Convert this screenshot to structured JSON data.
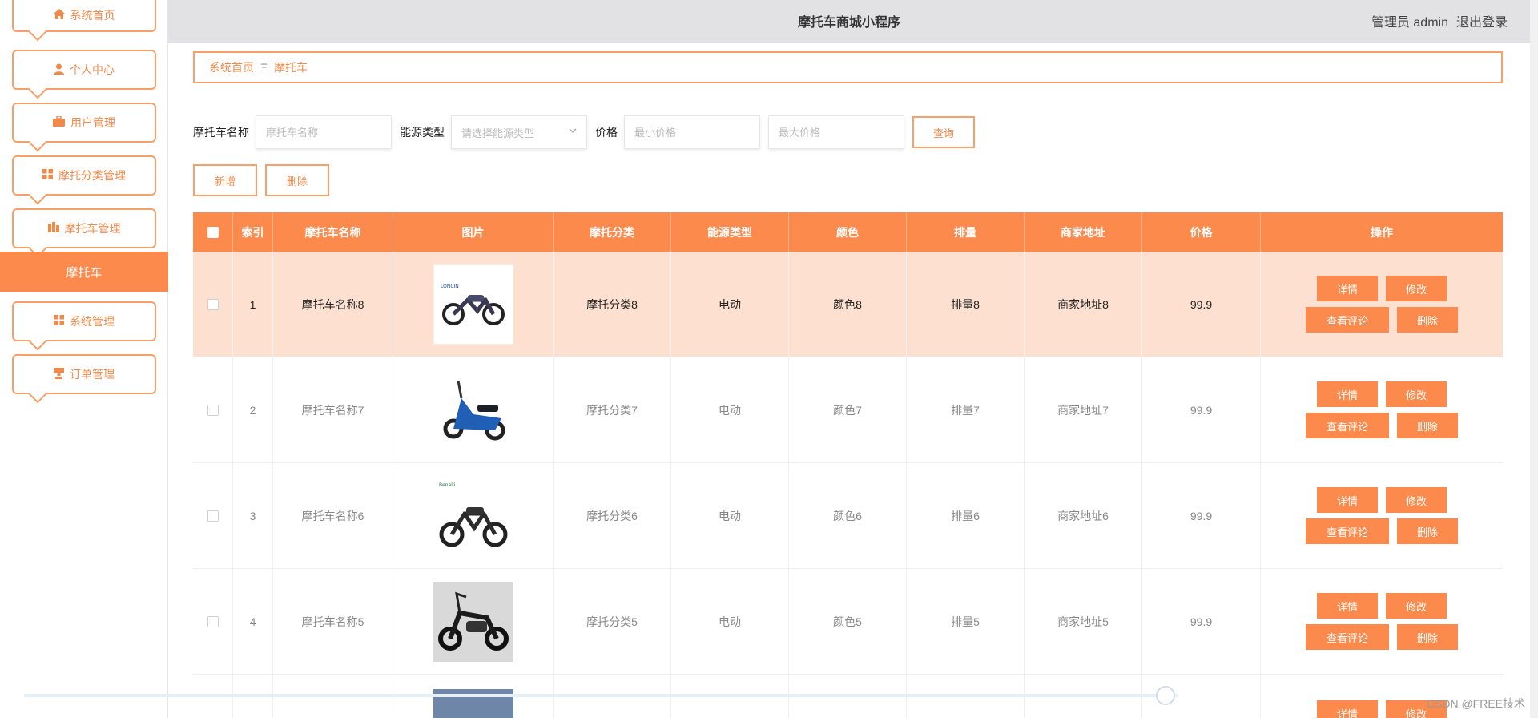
{
  "header": {
    "title": "摩托车商城小程序",
    "user_label": "管理员 admin",
    "logout_label": "退出登录"
  },
  "sidebar": {
    "items": [
      {
        "icon": "home-icon",
        "label": "系统首页"
      },
      {
        "icon": "user-icon",
        "label": "个人中心"
      },
      {
        "icon": "briefcase-icon",
        "label": "用户管理"
      },
      {
        "icon": "grid-icon",
        "label": "摩托分类管理"
      },
      {
        "icon": "building-icon",
        "label": "摩托车管理"
      },
      {
        "icon": "grid-icon",
        "label": "系统管理"
      },
      {
        "icon": "stamp-icon",
        "label": "订单管理"
      }
    ],
    "active_label": "摩托车"
  },
  "breadcrumb": {
    "home": "系统首页",
    "separator": "Ξ",
    "current": "摩托车"
  },
  "filters": {
    "name_label": "摩托车名称",
    "name_placeholder": "摩托车名称",
    "energy_label": "能源类型",
    "energy_placeholder": "请选择能源类型",
    "price_label": "价格",
    "min_price_placeholder": "最小价格",
    "max_price_placeholder": "最大价格",
    "query_label": "查询"
  },
  "actions": {
    "add_label": "新增",
    "delete_label": "删除"
  },
  "table": {
    "columns": [
      "索引",
      "摩托车名称",
      "图片",
      "摩托分类",
      "能源类型",
      "颜色",
      "排量",
      "商家地址",
      "价格",
      "操作"
    ],
    "rows": [
      {
        "index": "1",
        "name": "摩托车名称8",
        "category": "摩托分类8",
        "energy": "电动",
        "color": "颜色8",
        "displacement": "排量8",
        "address": "商家地址8",
        "price": "99.9"
      },
      {
        "index": "2",
        "name": "摩托车名称7",
        "category": "摩托分类7",
        "energy": "电动",
        "color": "颜色7",
        "displacement": "排量7",
        "address": "商家地址7",
        "price": "99.9"
      },
      {
        "index": "3",
        "name": "摩托车名称6",
        "category": "摩托分类6",
        "energy": "电动",
        "color": "颜色6",
        "displacement": "排量6",
        "address": "商家地址6",
        "price": "99.9"
      },
      {
        "index": "4",
        "name": "摩托车名称5",
        "category": "摩托分类5",
        "energy": "电动",
        "color": "颜色5",
        "displacement": "排量5",
        "address": "商家地址5",
        "price": "99.9"
      }
    ],
    "op_labels": {
      "detail": "详情",
      "edit": "修改",
      "comments": "查看评论",
      "delete": "删除"
    },
    "partial_row": {
      "detail": "详情",
      "edit": "修改"
    }
  },
  "watermark": "CSDN @FREE技术",
  "colors": {
    "accent": "#fb8a4c",
    "accent_border": "#f7a06a",
    "highlight_row": "#fde0cf"
  }
}
